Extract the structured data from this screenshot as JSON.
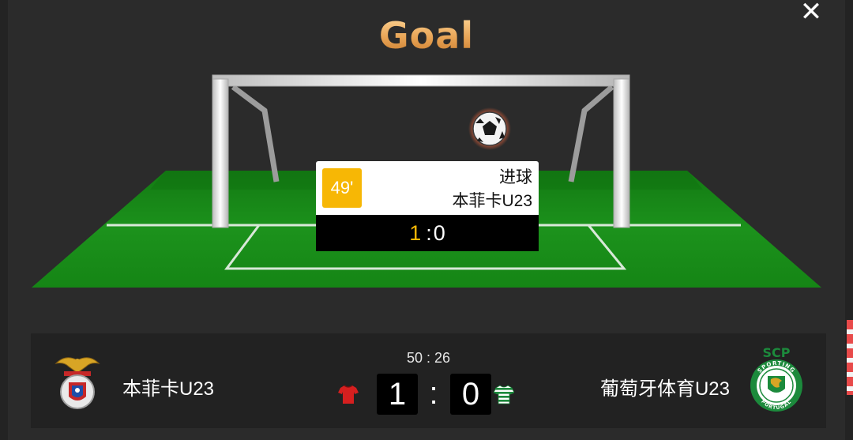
{
  "modal": {
    "title": "Goal",
    "close_label": "✕"
  },
  "event": {
    "minute": "49'",
    "type": "进球",
    "team": "本菲卡U23",
    "score_home": "1",
    "score_separator": ":",
    "score_away": "0"
  },
  "match": {
    "clock": "50 : 26",
    "home_team": "本菲卡U23",
    "away_team": "葡萄牙体育U23",
    "home_score": "1",
    "separator": ":",
    "away_score": "0",
    "away_logo_text_top": "SCP",
    "away_logo_text_ring": "SPORTING",
    "away_logo_text_bottom": "PORTUGAL"
  },
  "colors": {
    "accent": "#f7b705",
    "pitch": "#1f8f1f",
    "home_kit": "#d61f1f",
    "away_kit": "#1c8a3c",
    "title_gradient_top": "#ffd89a",
    "title_gradient_bottom": "#c97a2c"
  },
  "icons": {
    "ball": "soccer-ball-icon",
    "close": "close-icon",
    "home_kit": "red-shirt-icon",
    "away_kit": "striped-green-shirt-icon"
  }
}
